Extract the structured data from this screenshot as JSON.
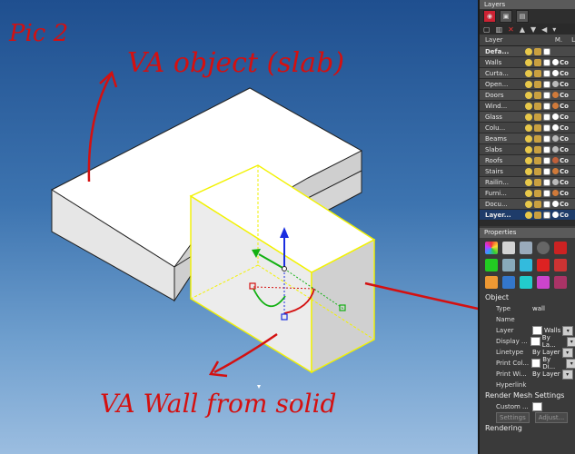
{
  "annotations": {
    "pic_label": "Pic 2",
    "slab_label": "VA object (slab)",
    "wall_label": "VA Wall from solid"
  },
  "layers_panel": {
    "title": "Layers",
    "columns": {
      "layer": "Layer",
      "m": "M.",
      "l": "Li"
    },
    "rows": [
      {
        "name": "Defa...",
        "bold": true,
        "mat": "",
        "trail": ""
      },
      {
        "name": "Walls",
        "bold": false,
        "mat": "#fff",
        "trail": "Co"
      },
      {
        "name": "Curta...",
        "bold": false,
        "mat": "#fff",
        "trail": "Co"
      },
      {
        "name": "Open...",
        "bold": false,
        "mat": "#bbb",
        "trail": "Co"
      },
      {
        "name": "Doors",
        "bold": false,
        "mat": "#d07a3a",
        "trail": "Co"
      },
      {
        "name": "Wind...",
        "bold": false,
        "mat": "#d07a3a",
        "trail": "Co"
      },
      {
        "name": "Glass",
        "bold": false,
        "mat": "#fff",
        "trail": "Co"
      },
      {
        "name": "Colu...",
        "bold": false,
        "mat": "#fff",
        "trail": "Co"
      },
      {
        "name": "Beams",
        "bold": false,
        "mat": "#bbb",
        "trail": "Co"
      },
      {
        "name": "Slabs",
        "bold": false,
        "mat": "#bbb",
        "trail": "Co"
      },
      {
        "name": "Roofs",
        "bold": false,
        "mat": "#c0603a",
        "trail": "Co"
      },
      {
        "name": "Stairs",
        "bold": false,
        "mat": "#d07a3a",
        "trail": "Co"
      },
      {
        "name": "Railin...",
        "bold": false,
        "mat": "#bbb",
        "trail": "Co"
      },
      {
        "name": "Furni...",
        "bold": false,
        "mat": "#d07a3a",
        "trail": "Co"
      },
      {
        "name": "Docu...",
        "bold": false,
        "mat": "#fff",
        "trail": "Co"
      },
      {
        "name": "Layer...",
        "bold": true,
        "mat": "#fff",
        "trail": "Co"
      }
    ]
  },
  "properties_panel": {
    "title": "Properties",
    "section_object": "Object",
    "rows": [
      {
        "label": "Type",
        "value": "wall",
        "kind": "text"
      },
      {
        "label": "Name",
        "value": "",
        "kind": "text"
      },
      {
        "label": "Layer",
        "value": "Walls",
        "kind": "box-dd"
      },
      {
        "label": "Display ...",
        "value": "By La...",
        "kind": "box-dd"
      },
      {
        "label": "Linetype",
        "value": "By Layer",
        "kind": "dd"
      },
      {
        "label": "Print Col...",
        "value": "By Di...",
        "kind": "box-dd"
      },
      {
        "label": "Print Wi...",
        "value": "By Layer",
        "kind": "dd"
      },
      {
        "label": "Hyperlink",
        "value": "",
        "kind": "text"
      }
    ],
    "section_render": "Render Mesh Settings",
    "custom_label": "Custom ...",
    "settings_label": "Settings",
    "adjust_label": "Adjust...",
    "section_rendering": "Rendering"
  },
  "colors": {
    "annotation_red": "#d41010",
    "selection_yellow": "#f2f200"
  }
}
